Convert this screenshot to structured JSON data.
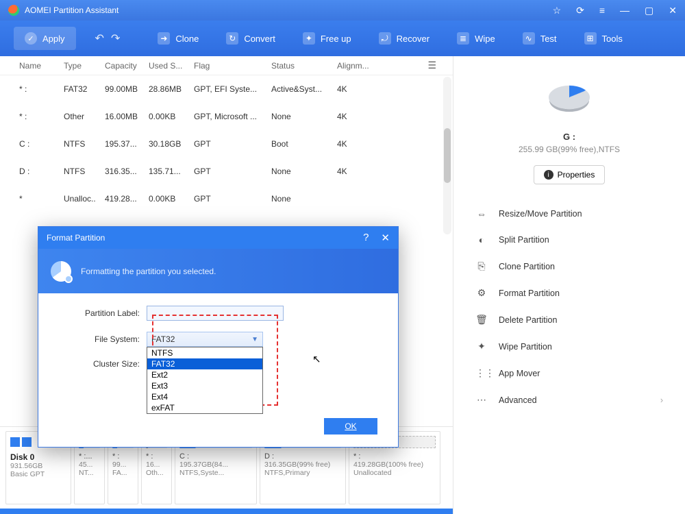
{
  "titlebar": {
    "title": "AOMEI Partition Assistant"
  },
  "toolbar": {
    "apply": "Apply",
    "items": [
      "Clone",
      "Convert",
      "Free up",
      "Recover",
      "Wipe",
      "Test",
      "Tools"
    ]
  },
  "columns": {
    "name": "Name",
    "type": "Type",
    "capacity": "Capacity",
    "used": "Used S...",
    "flag": "Flag",
    "status": "Status",
    "align": "Alignm..."
  },
  "rows": [
    {
      "name": "* :",
      "type": "FAT32",
      "cap": "99.00MB",
      "used": "28.86MB",
      "flag": "GPT, EFI Syste...",
      "status": "Active&Syst...",
      "align": "4K"
    },
    {
      "name": "* :",
      "type": "Other",
      "cap": "16.00MB",
      "used": "0.00KB",
      "flag": "GPT, Microsoft ...",
      "status": "None",
      "align": "4K"
    },
    {
      "name": "C :",
      "type": "NTFS",
      "cap": "195.37...",
      "used": "30.18GB",
      "flag": "GPT",
      "status": "Boot",
      "align": "4K"
    },
    {
      "name": "D :",
      "type": "NTFS",
      "cap": "316.35...",
      "used": "135.71...",
      "flag": "GPT",
      "status": "None",
      "align": "4K"
    },
    {
      "name": "*",
      "type": "Unalloc..",
      "cap": "419.28...",
      "used": "0.00KB",
      "flag": "GPT",
      "status": "None",
      "align": ""
    }
  ],
  "disk_strip": {
    "disk": {
      "name": "Disk 0",
      "size": "931.56GB",
      "scheme": "Basic GPT"
    },
    "parts": [
      {
        "name": "* :...",
        "l2": "45...",
        "l3": "NT..."
      },
      {
        "name": "* :",
        "l2": "99...",
        "l3": "FA..."
      },
      {
        "name": "* :",
        "l2": "16...",
        "l3": "Oth..."
      },
      {
        "name": "C :",
        "l2": "195.37GB(84...",
        "l3": "NTFS,Syste..."
      },
      {
        "name": "D :",
        "l2": "316.35GB(99% free)",
        "l3": "NTFS,Primary"
      },
      {
        "name": "* :",
        "l2": "419.28GB(100% free)",
        "l3": "Unallocated"
      }
    ]
  },
  "side": {
    "drive": "G :",
    "sub": "255.99 GB(99% free),NTFS",
    "properties": "Properties",
    "ops": [
      "Resize/Move Partition",
      "Split Partition",
      "Clone Partition",
      "Format Partition",
      "Delete Partition",
      "Wipe Partition",
      "App Mover",
      "Advanced"
    ]
  },
  "dialog": {
    "title": "Format Partition",
    "subtitle": "Formatting the partition you selected.",
    "label_partition": "Partition Label:",
    "label_fs": "File System:",
    "label_cluster": "Cluster Size:",
    "fs_value": "FAT32",
    "options": [
      "NTFS",
      "FAT32",
      "Ext2",
      "Ext3",
      "Ext4",
      "exFAT"
    ],
    "ok": "OK"
  }
}
